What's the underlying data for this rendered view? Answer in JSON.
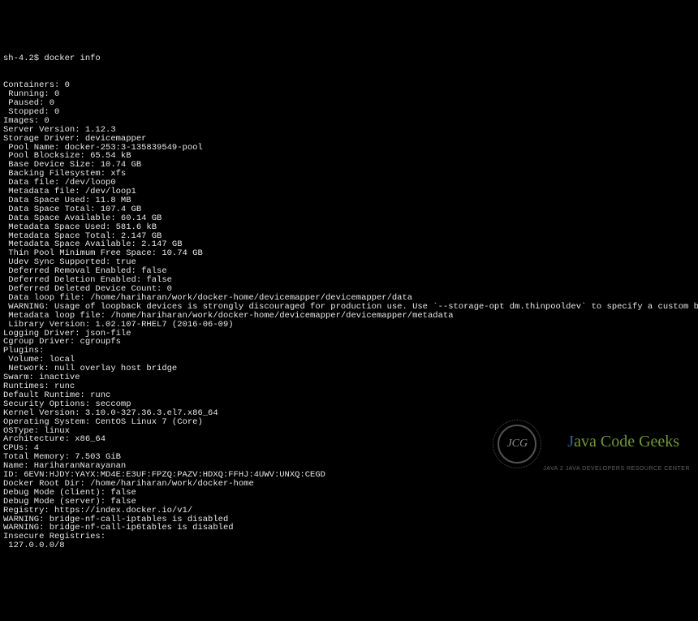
{
  "prompt": "sh-4.2$ docker info",
  "lines": [
    "Containers: 0",
    " Running: 0",
    " Paused: 0",
    " Stopped: 0",
    "Images: 0",
    "Server Version: 1.12.3",
    "Storage Driver: devicemapper",
    " Pool Name: docker-253:3-135839549-pool",
    " Pool Blocksize: 65.54 kB",
    " Base Device Size: 10.74 GB",
    " Backing Filesystem: xfs",
    " Data file: /dev/loop0",
    " Metadata file: /dev/loop1",
    " Data Space Used: 11.8 MB",
    " Data Space Total: 107.4 GB",
    " Data Space Available: 60.14 GB",
    " Metadata Space Used: 581.6 kB",
    " Metadata Space Total: 2.147 GB",
    " Metadata Space Available: 2.147 GB",
    " Thin Pool Minimum Free Space: 10.74 GB",
    " Udev Sync Supported: true",
    " Deferred Removal Enabled: false",
    " Deferred Deletion Enabled: false",
    " Deferred Deleted Device Count: 0",
    " Data loop file: /home/hariharan/work/docker-home/devicemapper/devicemapper/data",
    " WARNING: Usage of loopback devices is strongly discouraged for production use. Use `--storage-opt dm.thinpooldev` to specify a custom block storage device.",
    " Metadata loop file: /home/hariharan/work/docker-home/devicemapper/devicemapper/metadata",
    " Library Version: 1.02.107-RHEL7 (2016-06-09)",
    "Logging Driver: json-file",
    "Cgroup Driver: cgroupfs",
    "Plugins:",
    " Volume: local",
    " Network: null overlay host bridge",
    "Swarm: inactive",
    "Runtimes: runc",
    "Default Runtime: runc",
    "Security Options: seccomp",
    "Kernel Version: 3.10.0-327.36.3.el7.x86_64",
    "Operating System: CentOS Linux 7 (Core)",
    "OSType: linux",
    "Architecture: x86_64",
    "CPUs: 4",
    "Total Memory: 7.503 GiB",
    "Name: HariharanNarayanan",
    "ID: 6EVN:HJDY:YAYX:MD4E:E3UF:FPZQ:PAZV:HDXQ:FFHJ:4UWV:UNXQ:CEGD",
    "Docker Root Dir: /home/hariharan/work/docker-home",
    "Debug Mode (client): false",
    "Debug Mode (server): false",
    "Registry: https://index.docker.io/v1/",
    "WARNING: bridge-nf-call-iptables is disabled",
    "WARNING: bridge-nf-call-ip6tables is disabled",
    "Insecure Registries:",
    " 127.0.0.0/8"
  ],
  "watermark": {
    "logo_text": "JCG",
    "title_j": "J",
    "title_rest": "ava Code Geeks",
    "subtitle": "JAVA 2 JAVA DEVELOPERS RESOURCE CENTER"
  }
}
